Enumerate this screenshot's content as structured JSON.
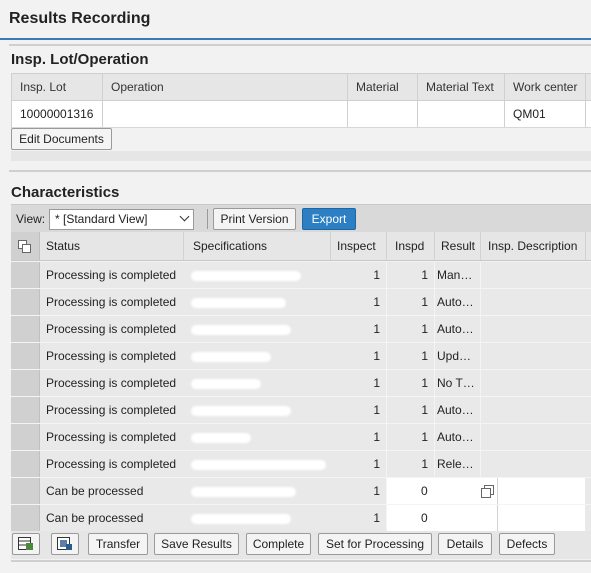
{
  "app": {
    "title": "Results Recording"
  },
  "lot_section": {
    "title": "Insp. Lot/Operation",
    "columns": [
      "Insp. Lot",
      "Operation",
      "Material",
      "Material Text",
      "Work center"
    ],
    "row": {
      "insp_lot": "10000001316",
      "operation": "",
      "material": "",
      "material_text": "",
      "work_center": "QM01"
    },
    "edit_documents": "Edit Documents"
  },
  "char_section": {
    "title": "Characteristics",
    "view_label": "View:",
    "view_value": "* [Standard View]",
    "print_version": "Print Version",
    "export": "Export",
    "columns": [
      "Status",
      "Specifications",
      "Inspect",
      "Inspd",
      "Result",
      "Insp. Description"
    ],
    "rows": [
      {
        "status": "Processing is completed",
        "inspect": "1",
        "inspd": "1",
        "result": "Man…"
      },
      {
        "status": "Processing is completed",
        "inspect": "1",
        "inspd": "1",
        "result": "Auto…"
      },
      {
        "status": "Processing is completed",
        "inspect": "1",
        "inspd": "1",
        "result": "Auto…"
      },
      {
        "status": "Processing is completed",
        "inspect": "1",
        "inspd": "1",
        "result": "Upd…"
      },
      {
        "status": "Processing is completed",
        "inspect": "1",
        "inspd": "1",
        "result": "No T…"
      },
      {
        "status": "Processing is completed",
        "inspect": "1",
        "inspd": "1",
        "result": "Auto…"
      },
      {
        "status": "Processing is completed",
        "inspect": "1",
        "inspd": "1",
        "result": "Auto…"
      },
      {
        "status": "Processing is completed",
        "inspect": "1",
        "inspd": "1",
        "result": "Rele…"
      },
      {
        "status": "Can be processed",
        "inspect": "1",
        "inspd": "0",
        "result": ""
      },
      {
        "status": "Can be processed",
        "inspect": "1",
        "inspd": "0",
        "result": ""
      }
    ]
  },
  "footer": {
    "transfer": "Transfer",
    "save_results": "Save Results",
    "complete": "Complete",
    "set_for_processing": "Set for Processing",
    "details": "Details",
    "defects": "Defects"
  },
  "colors": {
    "accent": "#3a7ab9",
    "primary_button": "#2c7fc2"
  }
}
